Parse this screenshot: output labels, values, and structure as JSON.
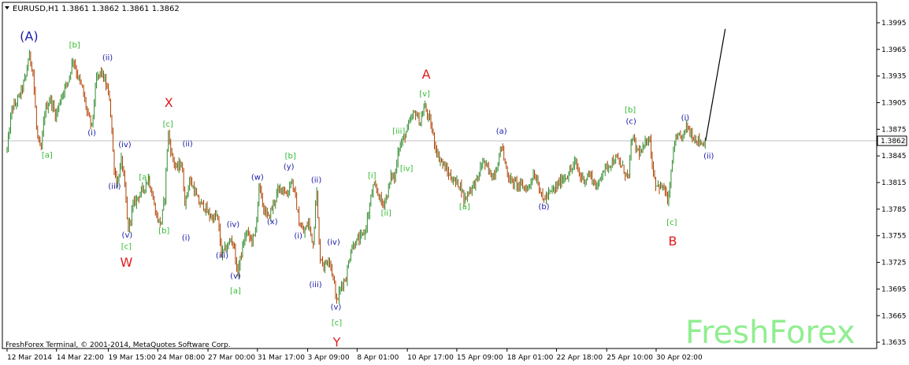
{
  "header": {
    "symbol_line": "EURUSD,H1  1.3861 1.3862 1.3861 1.3862"
  },
  "footer": {
    "copyright": "FreshForex Terminal, © 2001-2014, MetaQuotes Software Corp.",
    "watermark": "FreshForex"
  },
  "colors": {
    "up_candle": "#2e8b2e",
    "down_candle": "#b04000",
    "grid": "#c8c8c8",
    "current_price_line": "#c0c0c0",
    "wave_green": "#33bb33",
    "wave_blue": "#1a1aa8",
    "wave_red": "#e21b1b",
    "projection": "#000000"
  },
  "chart_data": {
    "type": "candlestick",
    "symbol": "EURUSD",
    "timeframe": "H1",
    "last_ohlc": {
      "open": 1.3861,
      "high": 1.3862,
      "low": 1.3861,
      "close": 1.3862
    },
    "current_price": 1.3862,
    "current_price_label": "1.3862",
    "ylim": [
      1.3628,
      1.4018
    ],
    "y_ticks": [
      {
        "value": 1.3995,
        "label": "1.3995"
      },
      {
        "value": 1.3965,
        "label": "1.3965"
      },
      {
        "value": 1.3935,
        "label": "1.3935"
      },
      {
        "value": 1.3905,
        "label": "1.3905"
      },
      {
        "value": 1.3875,
        "label": "1.3875"
      },
      {
        "value": 1.3845,
        "label": "1.3845"
      },
      {
        "value": 1.3815,
        "label": "1.3815"
      },
      {
        "value": 1.3785,
        "label": "1.3785"
      },
      {
        "value": 1.3755,
        "label": "1.3755"
      },
      {
        "value": 1.3725,
        "label": "1.3725"
      },
      {
        "value": 1.3695,
        "label": "1.3695"
      },
      {
        "value": 1.3665,
        "label": "1.3665"
      },
      {
        "value": 1.3635,
        "label": "1.3635"
      }
    ],
    "x_ticks": [
      {
        "t": 0,
        "label": "12 Mar 2014"
      },
      {
        "t": 63,
        "label": "14 Mar 22:00"
      },
      {
        "t": 129,
        "label": "19 Mar 15:00"
      },
      {
        "t": 192,
        "label": "24 Mar 08:00"
      },
      {
        "t": 256,
        "label": "27 Mar 00:00"
      },
      {
        "t": 319,
        "label": "31 Mar 17:00"
      },
      {
        "t": 383,
        "label": "3 Apr 09:00"
      },
      {
        "t": 446,
        "label": "8 Apr 01:00"
      },
      {
        "t": 510,
        "label": "10 Apr 17:00"
      },
      {
        "t": 573,
        "label": "15 Apr 09:00"
      },
      {
        "t": 637,
        "label": "18 Apr 01:00"
      },
      {
        "t": 700,
        "label": "22 Apr 18:00"
      },
      {
        "t": 764,
        "label": "25 Apr 10:00"
      },
      {
        "t": 827,
        "label": "30 Apr 02:00"
      }
    ],
    "t_range": [
      -6,
      1108
    ],
    "price_path": [
      [
        0,
        1.3852
      ],
      [
        6,
        1.3898
      ],
      [
        12,
        1.3905
      ],
      [
        18,
        1.3918
      ],
      [
        24,
        1.3935
      ],
      [
        28,
        1.396
      ],
      [
        33,
        1.394
      ],
      [
        38,
        1.387
      ],
      [
        43,
        1.3848
      ],
      [
        48,
        1.3895
      ],
      [
        55,
        1.391
      ],
      [
        62,
        1.389
      ],
      [
        70,
        1.3915
      ],
      [
        78,
        1.393
      ],
      [
        84,
        1.3955
      ],
      [
        90,
        1.3935
      ],
      [
        96,
        1.392
      ],
      [
        103,
        1.389
      ],
      [
        108,
        1.3878
      ],
      [
        114,
        1.3932
      ],
      [
        120,
        1.394
      ],
      [
        126,
        1.3925
      ],
      [
        131,
        1.3908
      ],
      [
        136,
        1.3835
      ],
      [
        140,
        1.3812
      ],
      [
        146,
        1.3842
      ],
      [
        151,
        1.38
      ],
      [
        154,
        1.376
      ],
      [
        160,
        1.3788
      ],
      [
        167,
        1.38
      ],
      [
        174,
        1.3808
      ],
      [
        180,
        1.382
      ],
      [
        186,
        1.3796
      ],
      [
        191,
        1.3775
      ],
      [
        196,
        1.3768
      ],
      [
        201,
        1.38
      ],
      [
        205,
        1.3872
      ],
      [
        210,
        1.3845
      ],
      [
        216,
        1.383
      ],
      [
        222,
        1.3838
      ],
      [
        227,
        1.379
      ],
      [
        232,
        1.3818
      ],
      [
        238,
        1.3808
      ],
      [
        244,
        1.3792
      ],
      [
        250,
        1.379
      ],
      [
        256,
        1.378
      ],
      [
        262,
        1.3775
      ],
      [
        268,
        1.3778
      ],
      [
        273,
        1.3735
      ],
      [
        280,
        1.3742
      ],
      [
        286,
        1.3752
      ],
      [
        290,
        1.374
      ],
      [
        293,
        1.371
      ],
      [
        299,
        1.3738
      ],
      [
        305,
        1.376
      ],
      [
        311,
        1.375
      ],
      [
        316,
        1.3755
      ],
      [
        321,
        1.381
      ],
      [
        327,
        1.3785
      ],
      [
        333,
        1.3775
      ],
      [
        339,
        1.379
      ],
      [
        345,
        1.3805
      ],
      [
        351,
        1.381
      ],
      [
        357,
        1.38
      ],
      [
        362,
        1.382
      ],
      [
        367,
        1.38
      ],
      [
        372,
        1.377
      ],
      [
        378,
        1.3758
      ],
      [
        384,
        1.377
      ],
      [
        390,
        1.3745
      ],
      [
        394,
        1.3812
      ],
      [
        398,
        1.3735
      ],
      [
        404,
        1.372
      ],
      [
        410,
        1.3732
      ],
      [
        416,
        1.3705
      ],
      [
        420,
        1.368
      ],
      [
        426,
        1.37
      ],
      [
        432,
        1.3708
      ],
      [
        438,
        1.374
      ],
      [
        444,
        1.3748
      ],
      [
        450,
        1.3752
      ],
      [
        456,
        1.376
      ],
      [
        462,
        1.3788
      ],
      [
        466,
        1.381
      ],
      [
        472,
        1.3805
      ],
      [
        478,
        1.379
      ],
      [
        484,
        1.38
      ],
      [
        490,
        1.3825
      ],
      [
        494,
        1.3818
      ],
      [
        498,
        1.3852
      ],
      [
        504,
        1.3862
      ],
      [
        510,
        1.3875
      ],
      [
        514,
        1.3885
      ],
      [
        520,
        1.3895
      ],
      [
        526,
        1.3882
      ],
      [
        532,
        1.3902
      ],
      [
        536,
        1.389
      ],
      [
        540,
        1.388
      ],
      [
        544,
        1.3862
      ],
      [
        549,
        1.3845
      ],
      [
        554,
        1.3838
      ],
      [
        560,
        1.3828
      ],
      [
        566,
        1.382
      ],
      [
        572,
        1.3815
      ],
      [
        578,
        1.3812
      ],
      [
        582,
        1.3795
      ],
      [
        588,
        1.3805
      ],
      [
        594,
        1.3812
      ],
      [
        600,
        1.382
      ],
      [
        606,
        1.384
      ],
      [
        612,
        1.383
      ],
      [
        618,
        1.3822
      ],
      [
        624,
        1.3832
      ],
      [
        630,
        1.3858
      ],
      [
        634,
        1.3838
      ],
      [
        640,
        1.3818
      ],
      [
        646,
        1.3815
      ],
      [
        652,
        1.3812
      ],
      [
        658,
        1.381
      ],
      [
        664,
        1.3808
      ],
      [
        670,
        1.3825
      ],
      [
        676,
        1.3818
      ],
      [
        682,
        1.3795
      ],
      [
        688,
        1.38
      ],
      [
        694,
        1.3805
      ],
      [
        700,
        1.381
      ],
      [
        706,
        1.3818
      ],
      [
        712,
        1.3822
      ],
      [
        718,
        1.3828
      ],
      [
        724,
        1.3838
      ],
      [
        730,
        1.3822
      ],
      [
        736,
        1.3818
      ],
      [
        742,
        1.3825
      ],
      [
        748,
        1.3815
      ],
      [
        752,
        1.3808
      ],
      [
        758,
        1.3828
      ],
      [
        764,
        1.3832
      ],
      [
        770,
        1.3838
      ],
      [
        776,
        1.3842
      ],
      [
        782,
        1.3835
      ],
      [
        788,
        1.3825
      ],
      [
        792,
        1.3822
      ],
      [
        796,
        1.3868
      ],
      [
        802,
        1.3852
      ],
      [
        808,
        1.3848
      ],
      [
        814,
        1.386
      ],
      [
        818,
        1.387
      ],
      [
        822,
        1.3835
      ],
      [
        826,
        1.3815
      ],
      [
        832,
        1.381
      ],
      [
        838,
        1.3808
      ],
      [
        842,
        1.379
      ],
      [
        846,
        1.3825
      ],
      [
        850,
        1.386
      ],
      [
        856,
        1.3865
      ],
      [
        862,
        1.3868
      ],
      [
        866,
        1.388
      ],
      [
        870,
        1.3872
      ],
      [
        876,
        1.3865
      ],
      [
        882,
        1.3862
      ],
      [
        887,
        1.3858
      ],
      [
        890,
        1.3862
      ]
    ],
    "projection_line": [
      [
        890,
        1.3862
      ],
      [
        915,
        1.3988
      ]
    ],
    "wave_labels": [
      {
        "text": "(A)",
        "t": 28,
        "price": 1.3975,
        "color": "blue",
        "size": "big"
      },
      {
        "text": "[b]",
        "t": 86,
        "price": 1.3967,
        "color": "green",
        "size": "small"
      },
      {
        "text": "(ii)",
        "t": 128,
        "price": 1.3953,
        "color": "blue",
        "size": "small"
      },
      {
        "text": "(i)",
        "t": 108,
        "price": 1.3868,
        "color": "blue",
        "size": "small"
      },
      {
        "text": "[a]",
        "t": 51,
        "price": 1.3843,
        "color": "green",
        "size": "small"
      },
      {
        "text": "(iv)",
        "t": 150,
        "price": 1.3855,
        "color": "blue",
        "size": "small"
      },
      {
        "text": "(iii)",
        "t": 137,
        "price": 1.3808,
        "color": "blue",
        "size": "small"
      },
      {
        "text": "[a]",
        "t": 175,
        "price": 1.3818,
        "color": "green",
        "size": "small"
      },
      {
        "text": "(v)",
        "t": 153,
        "price": 1.3753,
        "color": "blue",
        "size": "small"
      },
      {
        "text": "[c]",
        "t": 152,
        "price": 1.374,
        "color": "green",
        "size": "small"
      },
      {
        "text": "W",
        "t": 152,
        "price": 1.372,
        "color": "red",
        "size": "big"
      },
      {
        "text": "X",
        "t": 206,
        "price": 1.39,
        "color": "red",
        "size": "big"
      },
      {
        "text": "[c]",
        "t": 205,
        "price": 1.3878,
        "color": "green",
        "size": "small"
      },
      {
        "text": "(ii)",
        "t": 230,
        "price": 1.3856,
        "color": "blue",
        "size": "small"
      },
      {
        "text": "[b]",
        "t": 200,
        "price": 1.3758,
        "color": "green",
        "size": "small"
      },
      {
        "text": "(i)",
        "t": 228,
        "price": 1.375,
        "color": "blue",
        "size": "small"
      },
      {
        "text": "(w)",
        "t": 319,
        "price": 1.3818,
        "color": "blue",
        "size": "small"
      },
      {
        "text": "[b]",
        "t": 361,
        "price": 1.3842,
        "color": "green",
        "size": "small"
      },
      {
        "text": "(y)",
        "t": 359,
        "price": 1.383,
        "color": "blue",
        "size": "small"
      },
      {
        "text": "(ii)",
        "t": 394,
        "price": 1.3815,
        "color": "blue",
        "size": "small"
      },
      {
        "text": "(iv)",
        "t": 288,
        "price": 1.3765,
        "color": "blue",
        "size": "small"
      },
      {
        "text": "(x)",
        "t": 338,
        "price": 1.3768,
        "color": "blue",
        "size": "small"
      },
      {
        "text": "(i)",
        "t": 371,
        "price": 1.3752,
        "color": "blue",
        "size": "small"
      },
      {
        "text": "(iii)",
        "t": 274,
        "price": 1.373,
        "color": "blue",
        "size": "small"
      },
      {
        "text": "(v)",
        "t": 291,
        "price": 1.3707,
        "color": "blue",
        "size": "small"
      },
      {
        "text": "[a]",
        "t": 291,
        "price": 1.369,
        "color": "green",
        "size": "small"
      },
      {
        "text": "(iv)",
        "t": 416,
        "price": 1.3745,
        "color": "blue",
        "size": "small"
      },
      {
        "text": "(iii)",
        "t": 393,
        "price": 1.3697,
        "color": "blue",
        "size": "small"
      },
      {
        "text": "(v)",
        "t": 419,
        "price": 1.3672,
        "color": "blue",
        "size": "small"
      },
      {
        "text": "[c]",
        "t": 420,
        "price": 1.3654,
        "color": "green",
        "size": "small"
      },
      {
        "text": "Y",
        "t": 420,
        "price": 1.363,
        "color": "red",
        "size": "big"
      },
      {
        "text": "[i]",
        "t": 465,
        "price": 1.382,
        "color": "green",
        "size": "small"
      },
      {
        "text": "[ii]",
        "t": 483,
        "price": 1.3778,
        "color": "green",
        "size": "small"
      },
      {
        "text": "[iii]",
        "t": 499,
        "price": 1.387,
        "color": "green",
        "size": "small"
      },
      {
        "text": "[iv]",
        "t": 509,
        "price": 1.3828,
        "color": "green",
        "size": "small"
      },
      {
        "text": "[v]",
        "t": 532,
        "price": 1.3912,
        "color": "green",
        "size": "small"
      },
      {
        "text": "A",
        "t": 534,
        "price": 1.3932,
        "color": "red",
        "size": "big"
      },
      {
        "text": "(a)",
        "t": 630,
        "price": 1.387,
        "color": "blue",
        "size": "small"
      },
      {
        "text": "[a]",
        "t": 583,
        "price": 1.3785,
        "color": "green",
        "size": "small"
      },
      {
        "text": "(b)",
        "t": 684,
        "price": 1.3785,
        "color": "blue",
        "size": "small"
      },
      {
        "text": "[b]",
        "t": 794,
        "price": 1.3894,
        "color": "green",
        "size": "small"
      },
      {
        "text": "(c)",
        "t": 795,
        "price": 1.3881,
        "color": "blue",
        "size": "small"
      },
      {
        "text": "(i)",
        "t": 864,
        "price": 1.3885,
        "color": "blue",
        "size": "small"
      },
      {
        "text": "(ii)",
        "t": 894,
        "price": 1.3842,
        "color": "blue",
        "size": "small"
      },
      {
        "text": "[c]",
        "t": 847,
        "price": 1.3767,
        "color": "green",
        "size": "small"
      },
      {
        "text": "B",
        "t": 848,
        "price": 1.3744,
        "color": "red",
        "size": "big"
      }
    ]
  }
}
